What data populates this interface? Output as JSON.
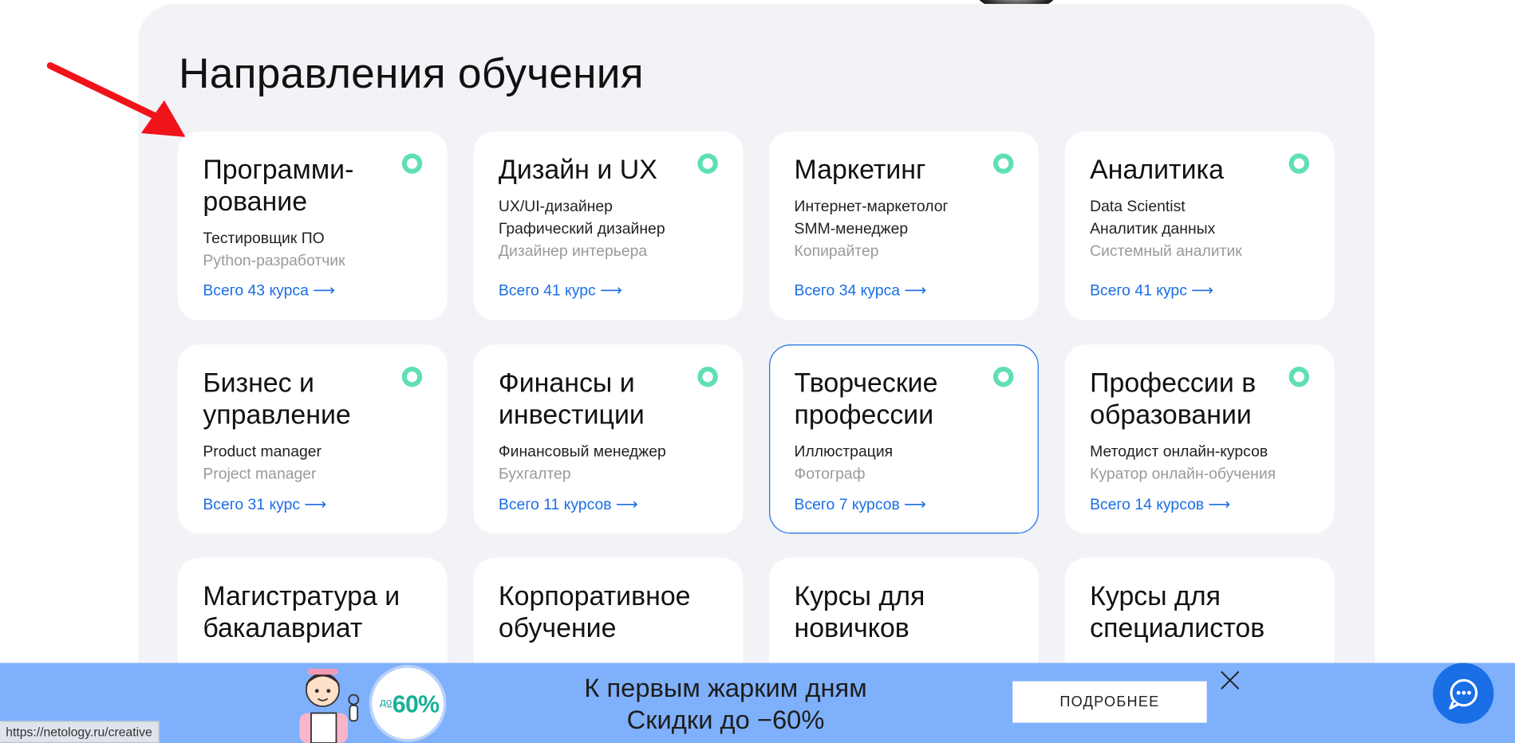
{
  "section": {
    "title": "Направления обучения"
  },
  "cards": [
    {
      "title": "Программи-рование",
      "professions": [
        "Тестировщик ПО",
        "Python-разработчик"
      ],
      "total": "Всего 43 курса ⟶"
    },
    {
      "title": "Дизайн и UX",
      "professions": [
        "UX/UI-дизайнер",
        "Графический дизайнер",
        "Дизайнер интерьера"
      ],
      "total": "Всего 41 курс ⟶"
    },
    {
      "title": "Маркетинг",
      "professions": [
        "Интернет-маркетолог",
        "SMM-менеджер",
        "Копирайтер"
      ],
      "total": "Всего 34 курса ⟶"
    },
    {
      "title": "Аналитика",
      "professions": [
        "Data Scientist",
        "Аналитик данных",
        "Системный аналитик"
      ],
      "total": "Всего 41 курс ⟶"
    },
    {
      "title": "Бизнес и управление",
      "professions": [
        "Product manager",
        "Project manager"
      ],
      "total": "Всего 31 курс ⟶"
    },
    {
      "title": "Финансы и инвестиции",
      "professions": [
        "Финансовый менеджер",
        "Бухгалтер"
      ],
      "total": "Всего 11 курсов ⟶"
    },
    {
      "title": "Творческие профессии",
      "professions": [
        "Иллюстрация",
        "Фотограф"
      ],
      "total": "Всего 7 курсов ⟶"
    },
    {
      "title": "Профессии в образовании",
      "professions": [
        "Методист онлайн-курсов",
        "Куратор онлайн-обучения"
      ],
      "total": "Всего 14 курсов ⟶"
    },
    {
      "title": "Магистратура и бакалавриат",
      "professions": [],
      "total": ""
    },
    {
      "title": "Корпоративное обучение",
      "professions": [],
      "total": ""
    },
    {
      "title": "Курсы для новичков",
      "professions": [],
      "total": ""
    },
    {
      "title": "Курсы для специалистов",
      "professions": [],
      "total": ""
    }
  ],
  "promo": {
    "badge_prefix": "до",
    "badge_value": "60%",
    "line1": "К первым жарким дням",
    "line2": "Скидки до −60%",
    "button": "ПОДРОБНЕЕ"
  },
  "status_url": "https://netology.ru/creative",
  "colors": {
    "accent": "#1a6ee6",
    "dot": "#5ee0b0",
    "banner": "#7fb0fb",
    "panel": "#f2f3f7"
  },
  "icons": {
    "close": "close-icon",
    "chat": "chat-icon",
    "arrow": "red-arrow-annotation"
  }
}
